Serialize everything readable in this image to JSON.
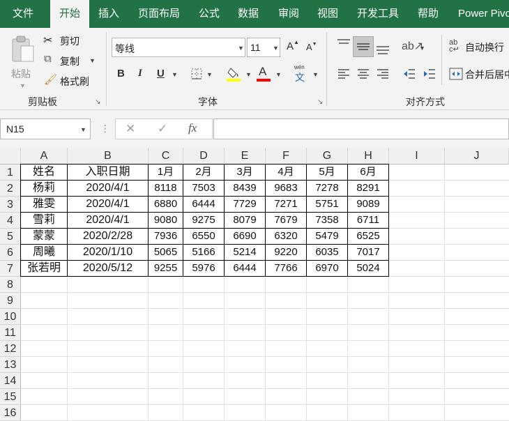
{
  "tabs": [
    "文件",
    "开始",
    "插入",
    "页面布局",
    "公式",
    "数据",
    "审阅",
    "视图",
    "开发工具",
    "帮助",
    "Power Pivot"
  ],
  "active_tab": "开始",
  "clipboard": {
    "paste": "粘贴",
    "cut": "剪切",
    "copy": "复制",
    "format_painter": "格式刷",
    "label": "剪贴板"
  },
  "font": {
    "name": "等线",
    "size": "11",
    "grow": "A",
    "shrink": "A",
    "bold": "B",
    "italic": "I",
    "underline": "U",
    "font_color": "A",
    "phonetic": "wén",
    "phonetic_char": "文",
    "label": "字体"
  },
  "alignment": {
    "wrap_text": "自动换行",
    "merge_center": "合并后居中",
    "label": "对齐方式"
  },
  "formula_bar": {
    "name_box": "N15",
    "cancel": "✕",
    "enter": "✓",
    "fx": "fx",
    "value": ""
  },
  "colors": {
    "accent": "#217346",
    "fill_highlight": "#ffff00",
    "font_red": "#ff0000"
  },
  "columns": [
    "A",
    "B",
    "C",
    "D",
    "E",
    "F",
    "G",
    "H",
    "I",
    "J"
  ],
  "rows": [
    "1",
    "2",
    "3",
    "4",
    "5",
    "6",
    "7",
    "8",
    "9",
    "10",
    "11",
    "12",
    "13",
    "14",
    "15",
    "16"
  ],
  "table": [
    [
      "姓名",
      "入职日期",
      "1月",
      "2月",
      "3月",
      "4月",
      "5月",
      "6月"
    ],
    [
      "杨莉",
      "2020/4/1",
      "8118",
      "7503",
      "8439",
      "9683",
      "7278",
      "8291"
    ],
    [
      "雅雯",
      "2020/4/1",
      "6880",
      "6444",
      "7729",
      "7271",
      "5751",
      "9089"
    ],
    [
      "雪莉",
      "2020/4/1",
      "9080",
      "9275",
      "8079",
      "7679",
      "7358",
      "6711"
    ],
    [
      "蒙蒙",
      "2020/2/28",
      "7936",
      "6550",
      "6690",
      "6320",
      "5479",
      "6525"
    ],
    [
      "周曦",
      "2020/1/10",
      "5065",
      "5166",
      "5214",
      "9220",
      "6035",
      "7017"
    ],
    [
      "张若明",
      "2020/5/12",
      "9255",
      "5976",
      "6444",
      "7766",
      "6970",
      "5024"
    ]
  ]
}
